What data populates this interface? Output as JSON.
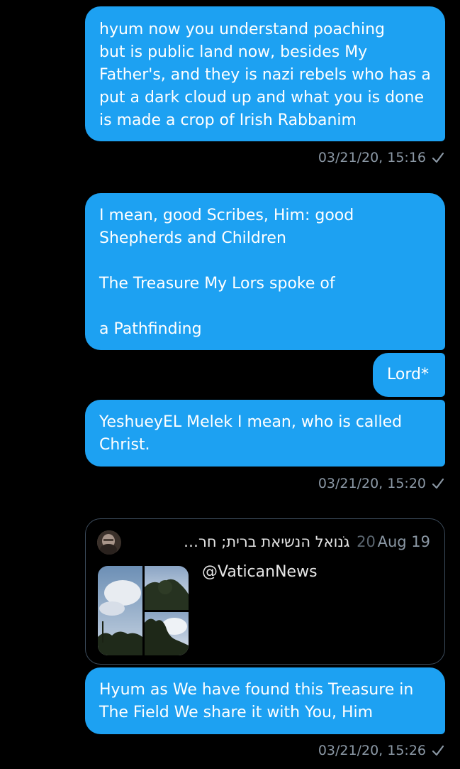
{
  "messages": [
    {
      "lines": [
        "hyum now you understand poaching",
        "but is public land now, besides My",
        "Father's, and they is nazi rebels who has a",
        "put a dark cloud up and what you is done",
        "is made a crop of Irish Rabbanim"
      ],
      "timestamp": "03/21/20, 15:16"
    },
    {
      "lines": [
        "I mean, good Scribes, Him: good",
        "Shepherds and Children",
        "",
        "The Treasure My Lors spoke of",
        "",
        "a Pathfinding"
      ]
    },
    {
      "lines": [
        "Lord*"
      ]
    },
    {
      "lines": [
        "YeshueyEL Melek I mean, who is called",
        "Christ."
      ],
      "timestamp": "03/21/20, 15:20"
    },
    {
      "lines": [
        "Hyum as We have found this Treasure in",
        "The Field We share it with You, Him"
      ],
      "timestamp": "03/21/20, 15:26"
    }
  ],
  "shared_tweet": {
    "author": "גנוׁאל הנשיאת ברית; חר…",
    "date": "Aug 19",
    "date_ghost": "20",
    "handle": "@VaticanNews"
  },
  "colors": {
    "bubble": "#1da1f2",
    "timestamp": "#8b98a5",
    "background": "#000000",
    "card_border": "#3b4a5a"
  },
  "icons": {
    "sent_check": "checkmark-icon",
    "avatar": "avatar"
  }
}
